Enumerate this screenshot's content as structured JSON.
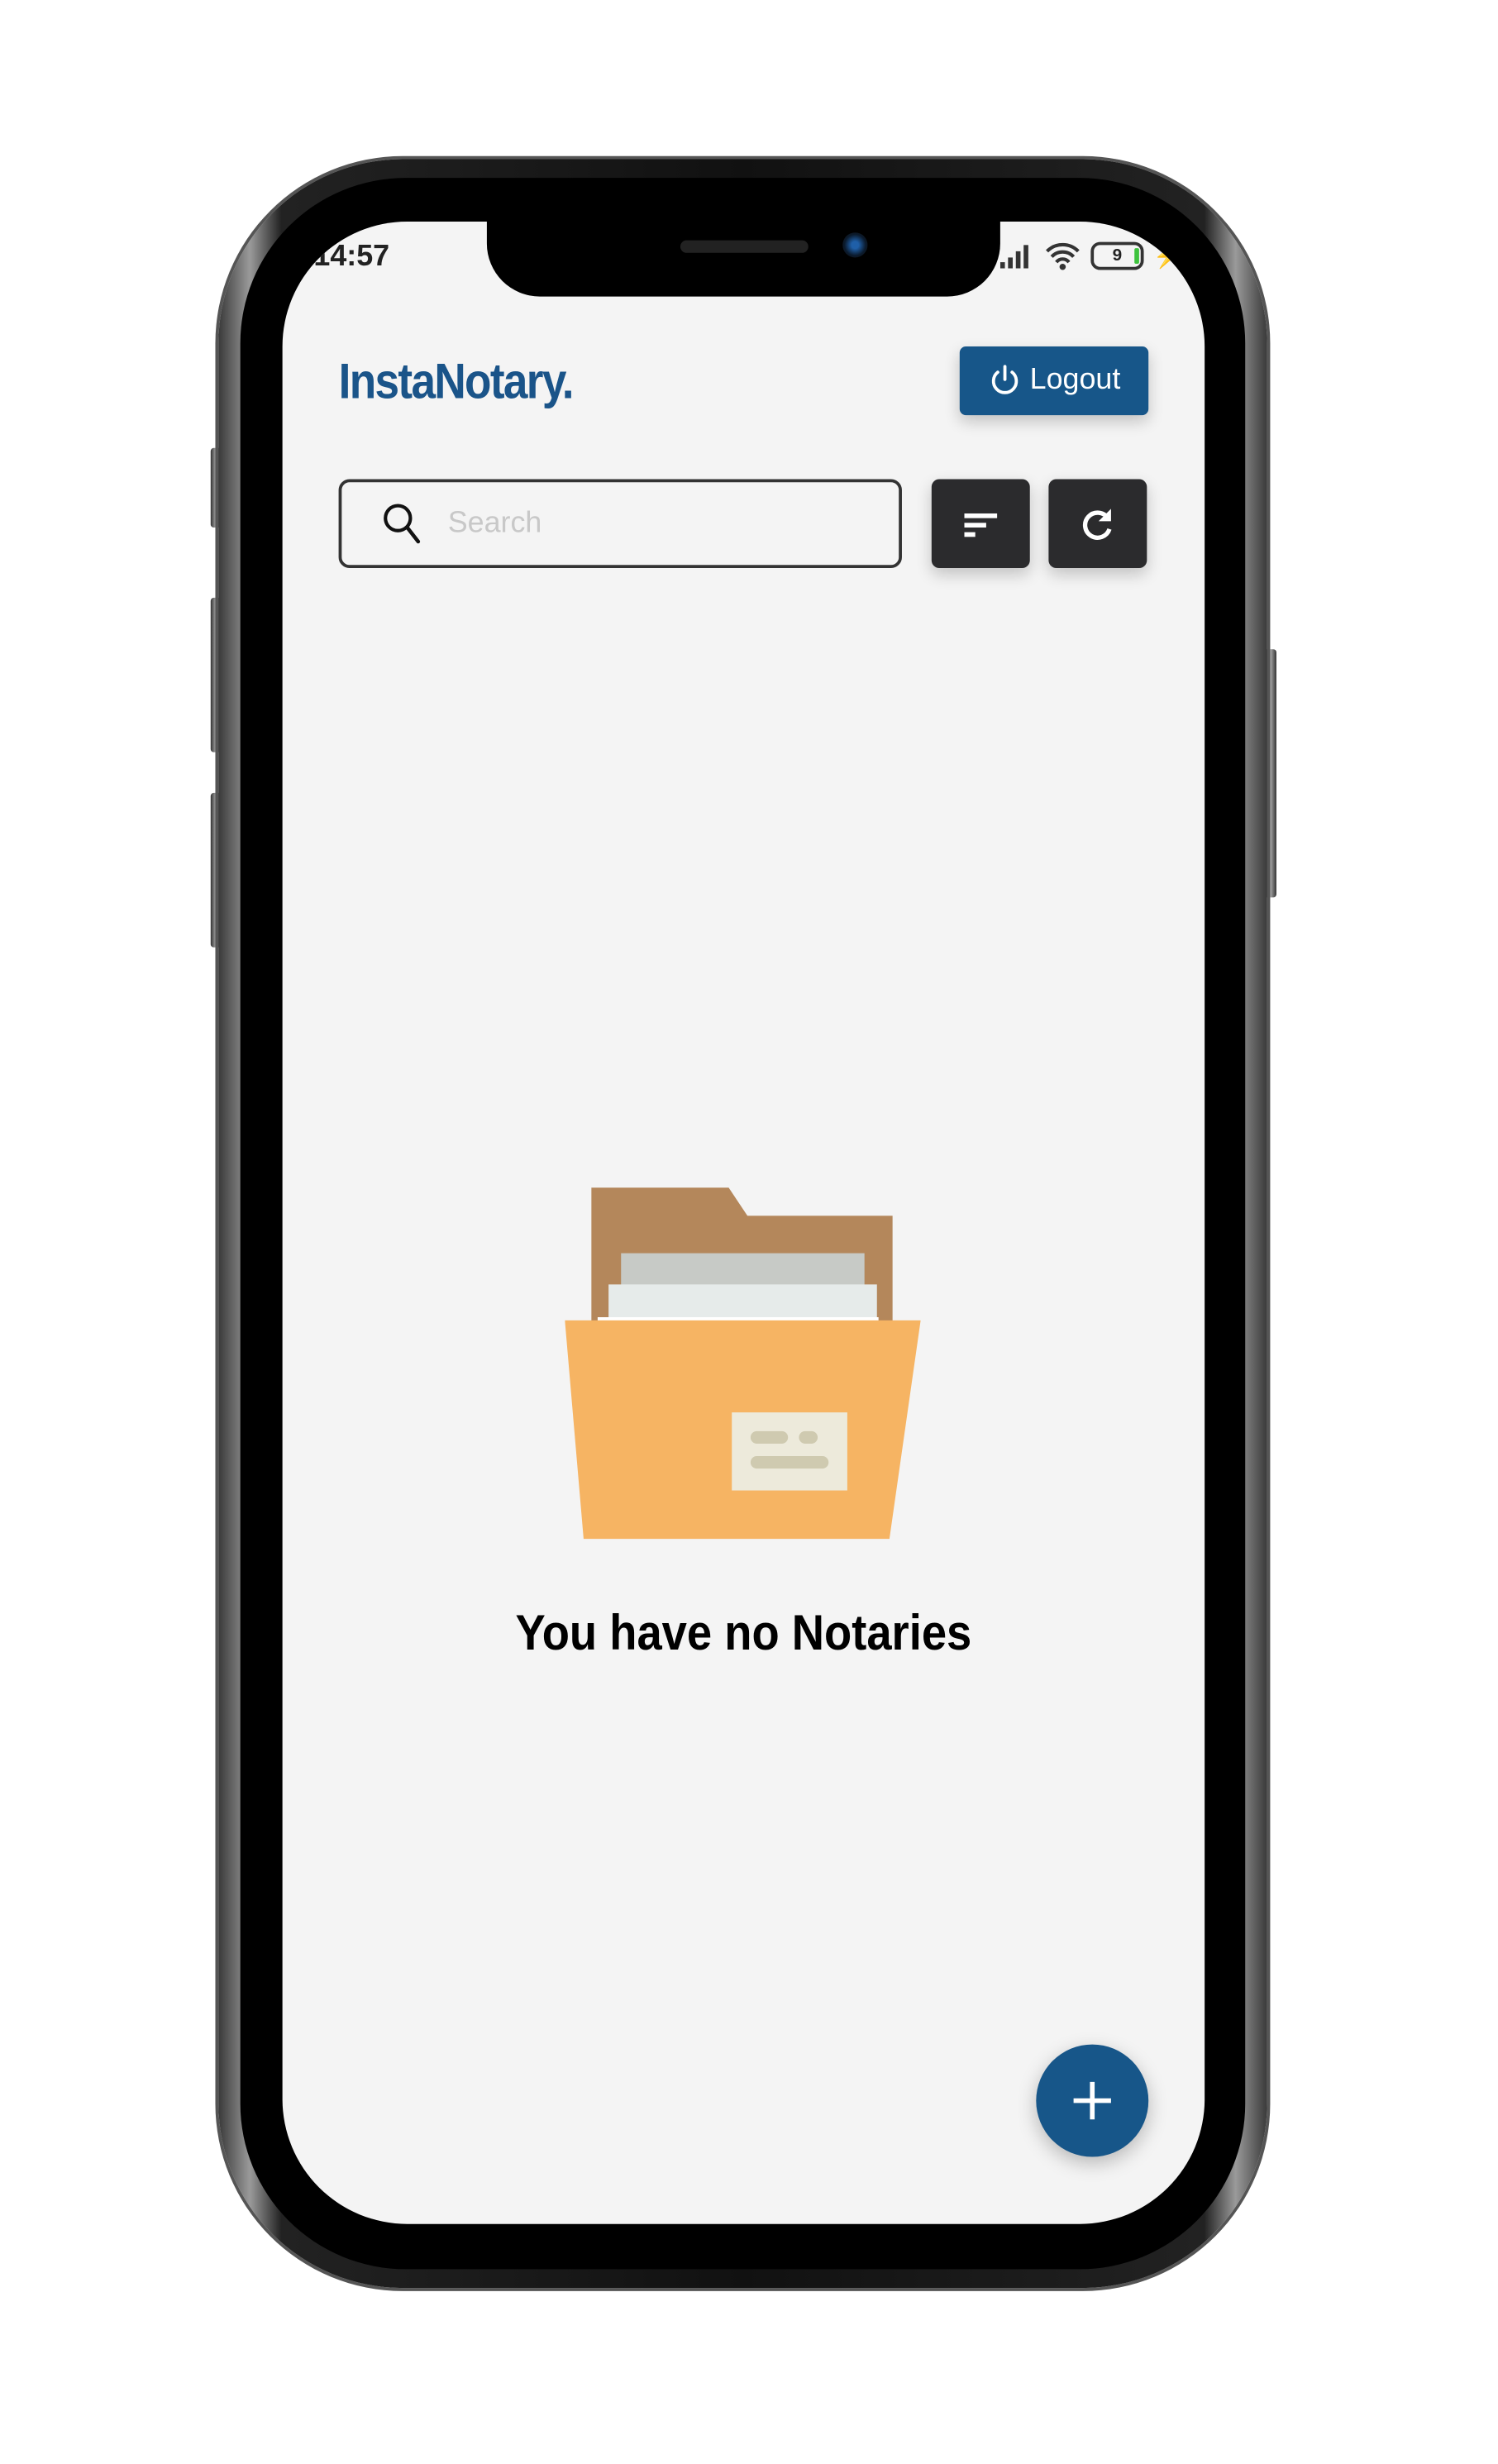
{
  "status_bar": {
    "time": "14:57",
    "battery": "9",
    "icons": [
      "signal-icon",
      "wifi-icon",
      "battery-icon",
      "charging-icon"
    ]
  },
  "header": {
    "app_title": "InstaNotary.",
    "logout_label": "Logout"
  },
  "search": {
    "placeholder": "Search",
    "value": ""
  },
  "toolbar": {
    "filter_icon": "filter-icon",
    "refresh_icon": "refresh-icon"
  },
  "empty_state": {
    "message": "You have no Notaries"
  },
  "colors": {
    "brand": "#175689",
    "dark_button": "#2b2b2d",
    "folder": "#f6b463",
    "folder_back": "#b4875b",
    "background": "#f4f4f4"
  }
}
